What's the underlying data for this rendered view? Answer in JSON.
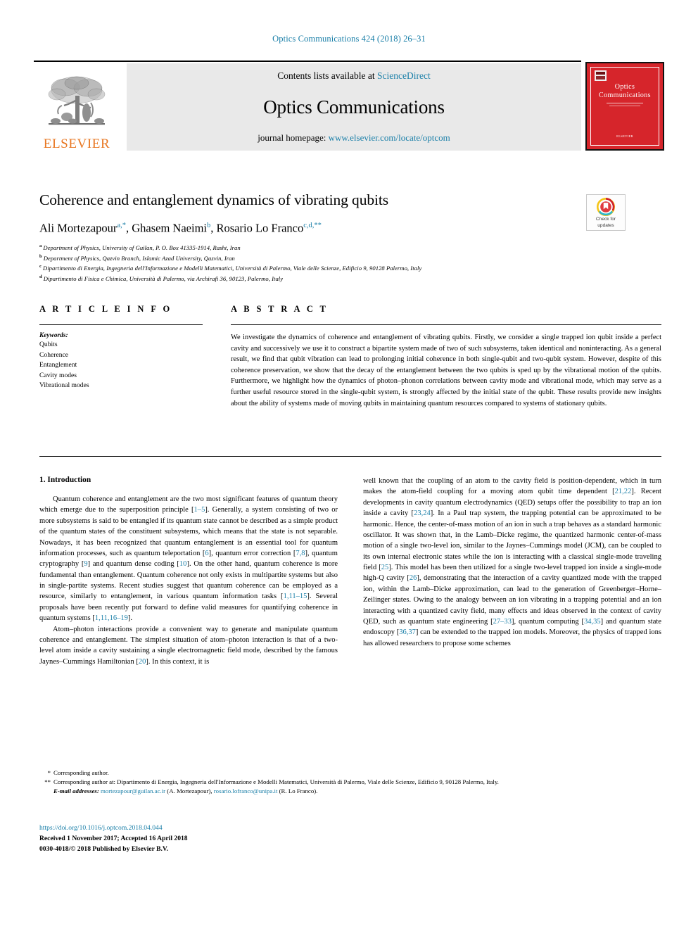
{
  "running_head": "Optics Communications 424 (2018) 26–31",
  "masthead": {
    "publisher_wordmark": "ELSEVIER",
    "contents_prefix": "Contents lists available at ",
    "contents_link": "ScienceDirect",
    "journal_title": "Optics Communications",
    "homepage_prefix": "journal homepage: ",
    "homepage_url": "www.elsevier.com/locate/optcom",
    "cover": {
      "line1": "Optics",
      "line2": "Communications",
      "footer": "ELSEVIER"
    }
  },
  "article": {
    "title": "Coherence and entanglement dynamics of vibrating qubits",
    "authors": [
      {
        "name": "Ali Mortezapour",
        "marks": "a,*"
      },
      {
        "name": "Ghasem Naeimi",
        "marks": "b"
      },
      {
        "name": "Rosario Lo Franco",
        "marks": "c,d,**"
      }
    ],
    "affiliations": [
      {
        "letter": "a",
        "text": "Department of Physics, University of Guilan, P. O. Box 41335-1914, Rasht, Iran"
      },
      {
        "letter": "b",
        "text": "Department of Physics, Qazvin Branch, Islamic Azad University, Qazvin, Iran"
      },
      {
        "letter": "c",
        "text": "Dipartimento di Energia, Ingegneria dell'Informazione e Modelli Matematici, Università di Palermo, Viale delle Scienze, Edificio 9, 90128 Palermo, Italy"
      },
      {
        "letter": "d",
        "text": "Dipartimento di Fisica e Chimica, Università di Palermo, via Archirafi 36, 90123, Palermo, Italy"
      }
    ],
    "crossmark": {
      "line1": "Check for",
      "line2": "updates",
      "icon": "crossmark-badge-icon"
    }
  },
  "article_info": {
    "heading": "A R T I C L E   I N F O",
    "keywords_label": "Keywords:",
    "keywords": [
      "Qubits",
      "Coherence",
      "Entanglement",
      "Cavity modes",
      "Vibrational modes"
    ]
  },
  "abstract": {
    "heading": "A B S T R A C T",
    "text": "We investigate the dynamics of coherence and entanglement of vibrating qubits. Firstly, we consider a single trapped ion qubit inside a perfect cavity and successively we use it to construct a bipartite system made of two of such subsystems, taken identical and noninteracting. As a general result, we find that qubit vibration can lead to prolonging initial coherence in both single-qubit and two-qubit system. However, despite of this coherence preservation, we show that the decay of the entanglement between the two qubits is sped up by the vibrational motion of the qubits. Furthermore, we highlight how the dynamics of photon–phonon correlations between cavity mode and vibrational mode, which may serve as a further useful resource stored in the single-qubit system, is strongly affected by the initial state of the qubit. These results provide new insights about the ability of systems made of moving qubits in maintaining quantum resources compared to systems of stationary qubits."
  },
  "body": {
    "section_title": "1.  Introduction",
    "left_paragraphs": [
      "Quantum coherence and entanglement are the two most significant features of quantum theory which emerge due to the superposition principle [1–5]. Generally, a system consisting of two or more subsystems is said to be entangled if its quantum state cannot be described as a simple product of the quantum states of the constituent subsystems, which means that the state is not separable. Nowadays, it has been recognized that quantum entanglement is an essential tool for quantum information processes, such as quantum teleportation [6], quantum error correction [7,8], quantum cryptography [9] and quantum dense coding [10]. On the other hand, quantum coherence is more fundamental than entanglement. Quantum coherence not only exists in multipartite systems but also in single-partite systems. Recent studies suggest that quantum coherence can be employed as a resource, similarly to entanglement, in various quantum information tasks [1,11–15]. Several proposals have been recently put forward to define valid measures for quantifying coherence in quantum systems [1,11,16–19].",
      "Atom–photon interactions provide a convenient way to generate and manipulate quantum coherence and entanglement. The simplest situation of atom–photon interaction is that of a two-level atom inside a cavity sustaining a single electromagnetic field mode, described by the famous Jaynes–Cummings Hamiltonian [20]. In this context, it is"
    ],
    "right_paragraphs": [
      "well known that the coupling of an atom to the cavity field is position-dependent, which in turn makes the atom-field coupling for a moving atom qubit time dependent [21,22]. Recent developments in cavity quantum electrodynamics (QED) setups offer the possibility to trap an ion inside a cavity [23,24]. In a Paul trap system, the trapping potential can be approximated to be harmonic. Hence, the center-of-mass motion of an ion in such a trap behaves as a standard harmonic oscillator. It was shown that, in the Lamb–Dicke regime, the quantized harmonic center-of-mass motion of a single two-level ion, similar to the Jaynes–Cummings model (JCM), can be coupled to its own internal electronic states while the ion is interacting with a classical single-mode traveling field [25]. This model has been then utilized for a single two-level trapped ion inside a single-mode high-Q cavity [26], demonstrating that the interaction of a cavity quantized mode with the trapped ion, within the Lamb–Dicke approximation, can lead to the generation of Greenberger–Horne–Zeilinger states. Owing to the analogy between an ion vibrating in a trapping potential and an ion interacting with a quantized cavity field, many effects and ideas observed in the context of cavity QED, such as quantum state engineering [27–33], quantum computing [34,35] and quantum state endoscopy [36,37] can be extended to the trapped ion models. Moreover, the physics of trapped ions has allowed researchers to propose some schemes"
    ]
  },
  "footnotes": {
    "star_single": "*",
    "star_double": "**",
    "corresponding_author": "Corresponding author.",
    "corresponding_author_at": "Corresponding author at: Dipartimento di Energia, Ingegneria dell'Informazione e Modelli Matematici, Università di Palermo, Viale delle Scienze, Edificio 9, 90128 Palermo, Italy.",
    "email_label": "E-mail addresses:",
    "email_1": "mortezapour@guilan.ac.ir",
    "email_1_owner": "(A. Mortezapour),",
    "email_2": "rosario.lofranco@unipa.it",
    "email_2_owner": "(R. Lo Franco)."
  },
  "publication": {
    "doi": "https://doi.org/10.1016/j.optcom.2018.04.044",
    "received": "Received 1 November 2017; Accepted 16 April 2018",
    "issn": "0030-4018/© 2018 Published by Elsevier B.V."
  },
  "colors": {
    "link": "#1a7fa8",
    "elsevier_orange": "#E87722",
    "cover_red": "#d6252b",
    "band_gray": "#e9e9e9"
  }
}
